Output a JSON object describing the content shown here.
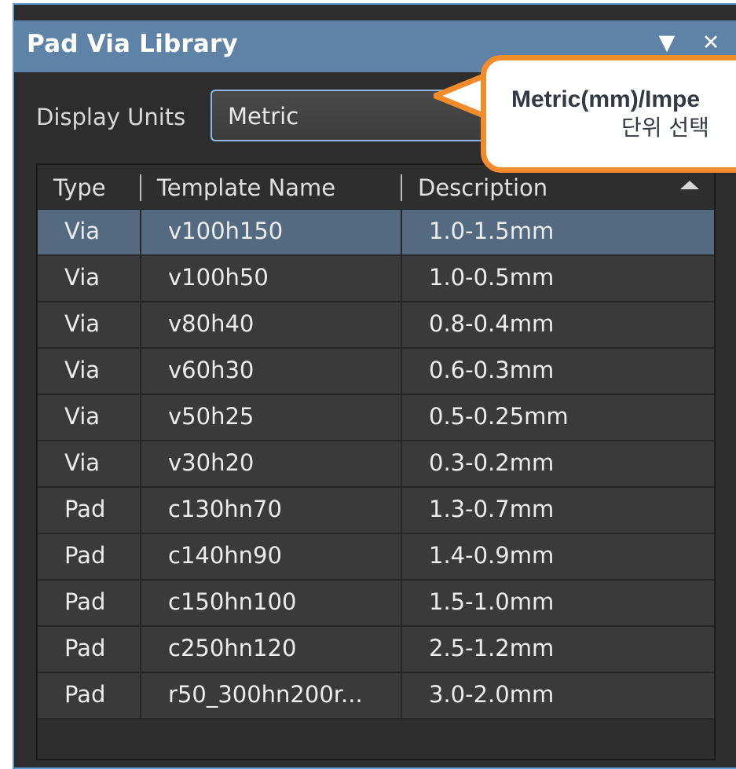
{
  "panel": {
    "title": "Pad Via Library",
    "menu_icon": "▼",
    "close_icon": "✕"
  },
  "display_units": {
    "label": "Display Units",
    "value": "Metric"
  },
  "table": {
    "columns": [
      "Type",
      "Template Name",
      "Description"
    ],
    "rows": [
      {
        "type": "Via",
        "name": "v100h150",
        "desc": "1.0-1.5mm"
      },
      {
        "type": "Via",
        "name": "v100h50",
        "desc": "1.0-0.5mm"
      },
      {
        "type": "Via",
        "name": "v80h40",
        "desc": "0.8-0.4mm"
      },
      {
        "type": "Via",
        "name": "v60h30",
        "desc": "0.6-0.3mm"
      },
      {
        "type": "Via",
        "name": "v50h25",
        "desc": "0.5-0.25mm"
      },
      {
        "type": "Via",
        "name": "v30h20",
        "desc": "0.3-0.2mm"
      },
      {
        "type": "Pad",
        "name": "c130hn70",
        "desc": "1.3-0.7mm"
      },
      {
        "type": "Pad",
        "name": "c140hn90",
        "desc": "1.4-0.9mm"
      },
      {
        "type": "Pad",
        "name": "c150hn100",
        "desc": "1.5-1.0mm"
      },
      {
        "type": "Pad",
        "name": "c250hn120",
        "desc": "2.5-1.2mm"
      },
      {
        "type": "Pad",
        "name": "r50_300hn200r...",
        "desc": "3.0-2.0mm"
      }
    ],
    "selected_index": 0
  },
  "callout": {
    "line1": "Metric(mm)/Impe",
    "line2": "단위 선택"
  },
  "colors": {
    "accent_orange": "#f28b2a",
    "titlebar": "#5f83a6",
    "selected_row": "#546a80"
  }
}
